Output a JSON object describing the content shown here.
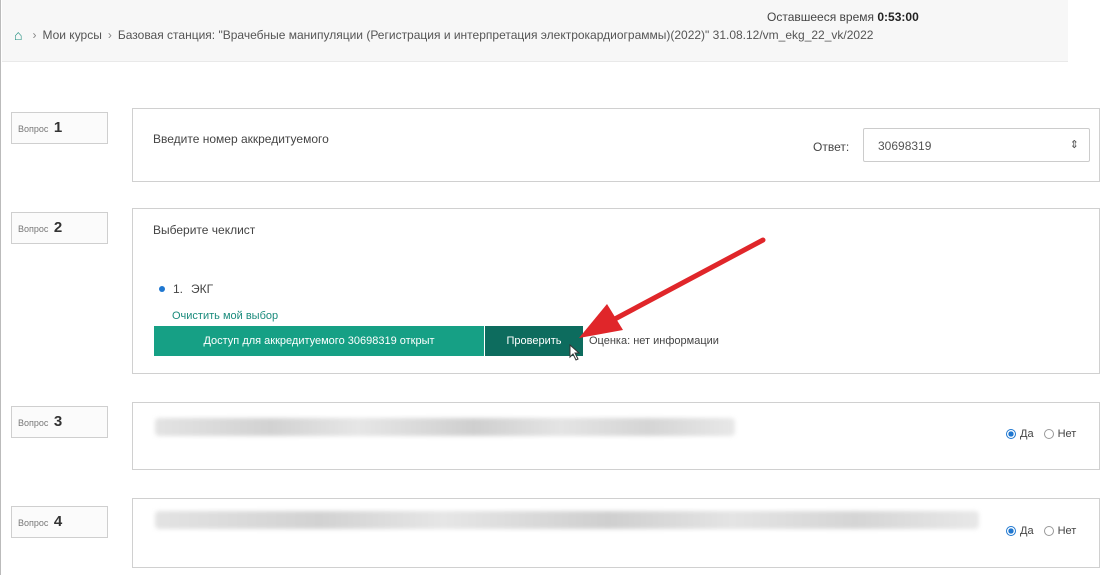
{
  "header": {
    "timer_label": "Оставшееся время",
    "timer_value": "0:53:00",
    "breadcrumb": {
      "home_icon": "home-icon",
      "items": [
        "Мои курсы",
        "Базовая станция: \"Врачебные манипуляции (Регистрация и интерпретация электрокардиограммы)(2022)\" 31.08.12/vm_ekg_22_vk/2022"
      ]
    }
  },
  "questions": [
    {
      "label": "Вопрос",
      "number": "1",
      "text": "Введите номер аккредитуемого",
      "answer_label": "Ответ:",
      "answer_value": "30698319"
    },
    {
      "label": "Вопрос",
      "number": "2",
      "text": "Выберите чеклист",
      "option_number": "1.",
      "option_text": "ЭКГ",
      "clear_link": "Очистить мой выбор",
      "access_button": "Доступ для аккредитуемого 30698319 открыт",
      "check_button": "Проверить",
      "grade_text": "Оценка: нет информации"
    },
    {
      "label": "Вопрос",
      "number": "3",
      "yes_label": "Да",
      "no_label": "Нет",
      "selected": "Да"
    },
    {
      "label": "Вопрос",
      "number": "4",
      "yes_label": "Да",
      "no_label": "Нет",
      "selected": "Да"
    }
  ],
  "colors": {
    "accent": "#16a085",
    "accent_dark": "#0d6c5e",
    "arrow": "#e0262a"
  }
}
